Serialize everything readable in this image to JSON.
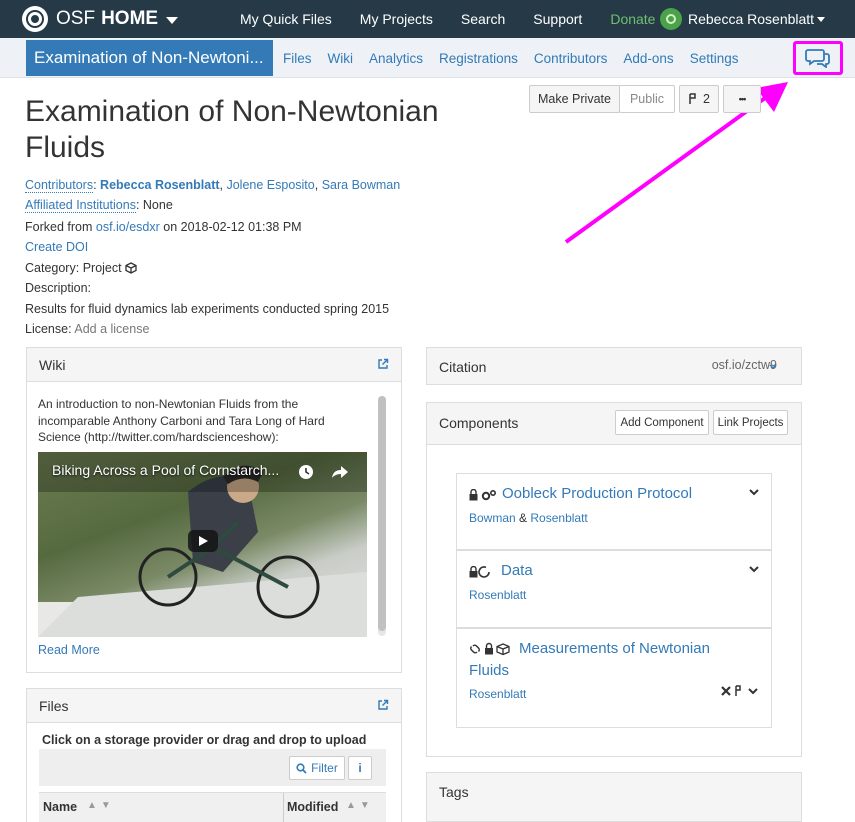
{
  "topnav": {
    "brand_a": "OSF",
    "brand_b": "HOME",
    "links": [
      "My Quick Files",
      "My Projects",
      "Search",
      "Support",
      "Donate"
    ],
    "user": "Rebecca Rosenblatt"
  },
  "projnav": {
    "title": "Examination of Non-Newtoni...",
    "links": [
      "Files",
      "Wiki",
      "Analytics",
      "Registrations",
      "Contributors",
      "Add-ons",
      "Settings"
    ]
  },
  "project": {
    "title": "Examination of Non-Newtonian Fluids",
    "buttons": {
      "make_private": "Make Private",
      "public": "Public",
      "forks": "2",
      "more": "•••"
    },
    "contributors_label": "Contributors",
    "contributors": [
      "Rebecca Rosenblatt",
      "Jolene Esposito",
      "Sara Bowman"
    ],
    "affiliated_label": "Affiliated Institutions",
    "affiliated_value": "None",
    "forked_prefix": "Forked from",
    "forked_link": "osf.io/esdxr",
    "forked_suffix": "on 2018-02-12 01:38 PM",
    "create_doi": "Create DOI",
    "category_label": "Category:",
    "category_value": "Project",
    "description_label": "Description:",
    "description_text": "Results for fluid dynamics lab experiments conducted spring 2015",
    "license_label": "License:",
    "license_value": "Add a license"
  },
  "wiki": {
    "title": "Wiki",
    "text": "An introduction to non-Newtonian Fluids from the incomparable Anthony Carboni and Tara Long of Hard Science (http://twitter.com/hardscienceshow):",
    "video_title": "Biking Across a Pool of Cornstarch...",
    "read_more": "Read More"
  },
  "files": {
    "title": "Files",
    "hint": "Click on a storage provider or drag and drop to upload",
    "filter": "Filter",
    "info": "i",
    "col_name": "Name",
    "col_modified": "Modified"
  },
  "citation": {
    "title": "Citation",
    "url": "osf.io/zctw9"
  },
  "components": {
    "title": "Components",
    "add": "Add Component",
    "link": "Link Projects",
    "items": [
      {
        "title": "Oobleck Production Protocol",
        "sub_a": "Bowman",
        "sub_amp": "&",
        "sub_b": "Rosenblatt"
      },
      {
        "title": "Data",
        "sub_a": "Rosenblatt"
      },
      {
        "title_1": "Measurements of Newtonian",
        "title_2": "Fluids",
        "sub_a": "Rosenblatt"
      }
    ]
  },
  "tags": {
    "title": "Tags"
  },
  "colors": {
    "topnav": "#263947",
    "link": "#337ab7",
    "donate": "#6fc06f",
    "annotation": "#ff00ff"
  }
}
